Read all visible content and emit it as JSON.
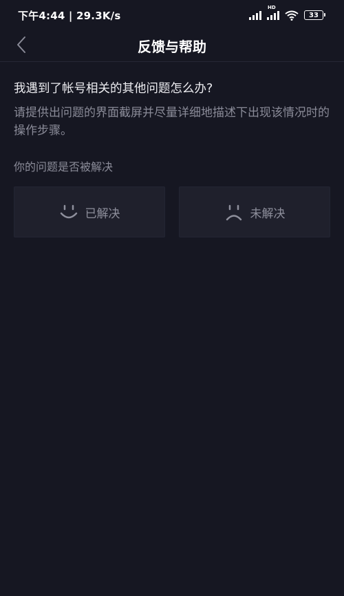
{
  "status_bar": {
    "left_text": "下午4:44 | 29.3K/s",
    "network_badge": "HD",
    "battery_level": "33"
  },
  "nav": {
    "title": "反馈与帮助"
  },
  "article": {
    "question": "我遇到了帐号相关的其他问题怎么办?",
    "answer": "请提供出问题的界面截屏并尽量详细地描述下出现该情况时的操作步骤。"
  },
  "feedback": {
    "prompt": "你的问题是否被解决",
    "solved_label": "已解决",
    "unsolved_label": "未解决"
  },
  "colors": {
    "background": "#161722",
    "button_background": "#1f202c",
    "muted_text": "#8a8b98"
  }
}
